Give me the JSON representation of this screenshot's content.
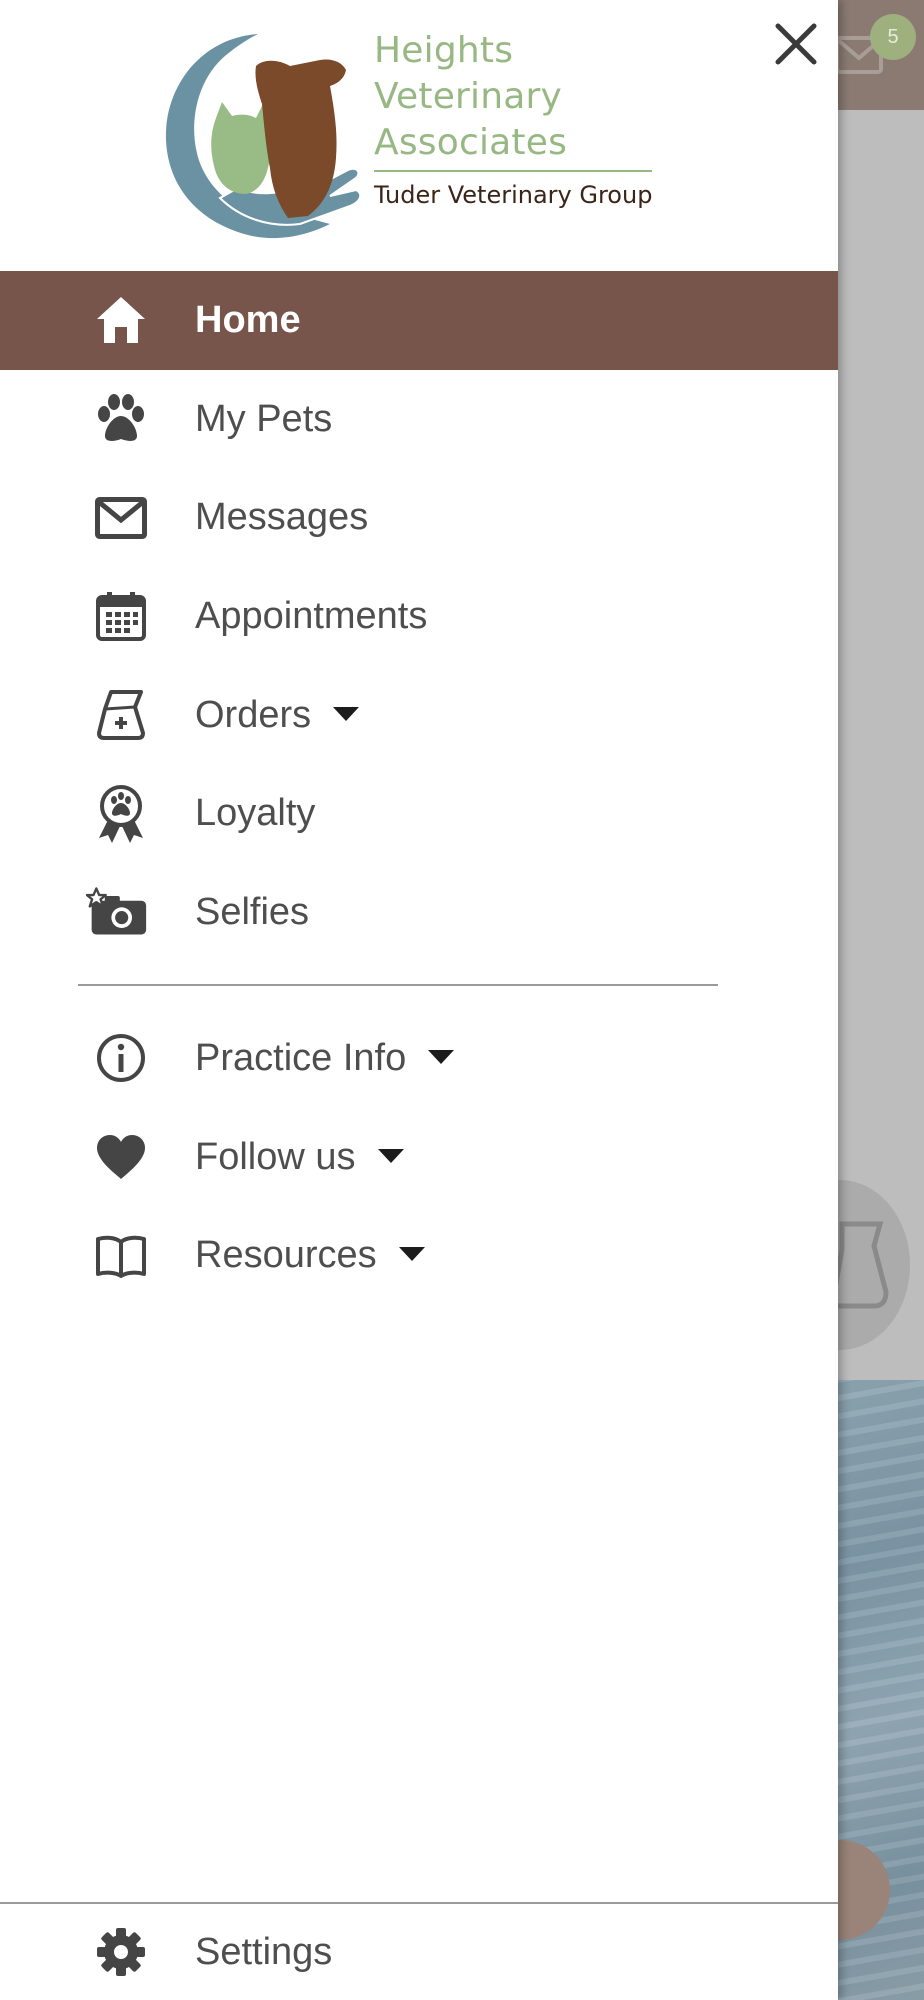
{
  "colors": {
    "active_bg": "#77554a",
    "brand_green": "#97b883",
    "brand_brown": "#7b4a2a",
    "brand_teal": "#5e8a9c",
    "text": "#4e4e4e",
    "icon": "#454545"
  },
  "background_app": {
    "mail_badge_count": "5",
    "mail_icon": "envelope-icon"
  },
  "drawer": {
    "close_icon": "close-icon",
    "logo": {
      "line1": "Heights",
      "line2": "Veterinary",
      "line3": "Associates",
      "subtitle": "Tuder Veterinary Group"
    },
    "primary_items": [
      {
        "label": "Home",
        "icon": "home-icon",
        "active": true,
        "has_caret": false
      },
      {
        "label": "My Pets",
        "icon": "paw-icon",
        "active": false,
        "has_caret": false
      },
      {
        "label": "Messages",
        "icon": "envelope-icon",
        "active": false,
        "has_caret": false
      },
      {
        "label": "Appointments",
        "icon": "calendar-icon",
        "active": false,
        "has_caret": false
      },
      {
        "label": "Orders",
        "icon": "food-bag-icon",
        "active": false,
        "has_caret": true
      },
      {
        "label": "Loyalty",
        "icon": "award-ribbon-icon",
        "active": false,
        "has_caret": false
      },
      {
        "label": "Selfies",
        "icon": "camera-star-icon",
        "active": false,
        "has_caret": false
      }
    ],
    "secondary_items": [
      {
        "label": "Practice Info",
        "icon": "info-icon",
        "has_caret": true
      },
      {
        "label": "Follow us",
        "icon": "heart-icon",
        "has_caret": true
      },
      {
        "label": "Resources",
        "icon": "book-icon",
        "has_caret": true
      }
    ],
    "settings": {
      "label": "Settings",
      "icon": "gear-icon"
    }
  }
}
